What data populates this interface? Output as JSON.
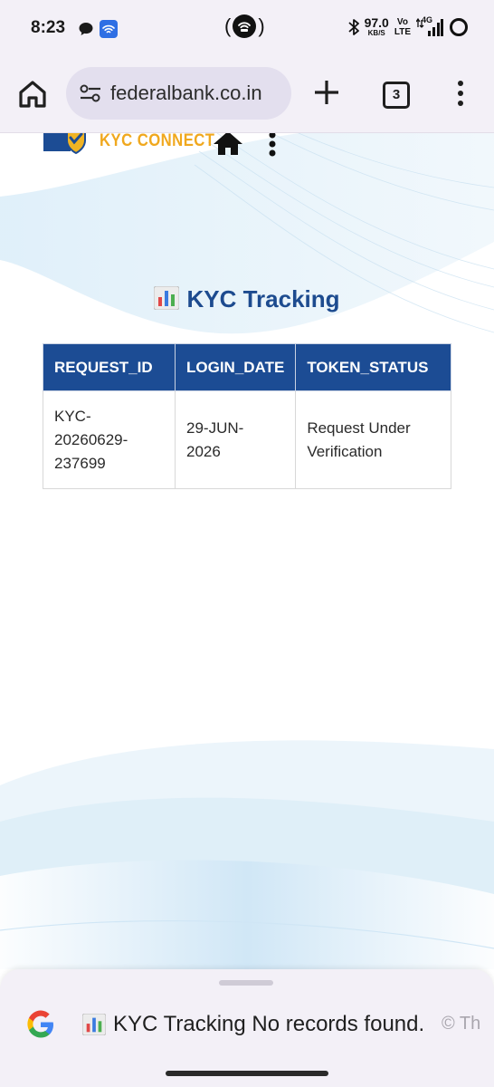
{
  "status_bar": {
    "time": "8:23",
    "speed_value": "97.0",
    "speed_unit": "KB/S",
    "volte_top": "Vo",
    "volte_bottom": "LTE",
    "network": "4G"
  },
  "browser": {
    "url": "federalbank.co.in",
    "tab_count": "3"
  },
  "page": {
    "logo_text": "KYC CONNECT",
    "heading": "KYC Tracking",
    "table": {
      "headers": [
        "REQUEST_ID",
        "LOGIN_DATE",
        "TOKEN_STATUS"
      ],
      "rows": [
        {
          "request_id_l1": "KYC-",
          "request_id_l2": "20260629-",
          "request_id_l3": "237699",
          "login_date_l1": "29-JUN-",
          "login_date_l2": "2026",
          "status_l1": "Request Under",
          "status_l2": "Verification"
        }
      ]
    }
  },
  "bottom_sheet": {
    "text": "KYC Tracking No records found.",
    "trailing": "© Th"
  },
  "colors": {
    "header_blue": "#1c4c94",
    "heading_blue": "#1d4b8f",
    "logo_orange": "#f0a81e",
    "chrome_bg": "#f3f0f7"
  }
}
